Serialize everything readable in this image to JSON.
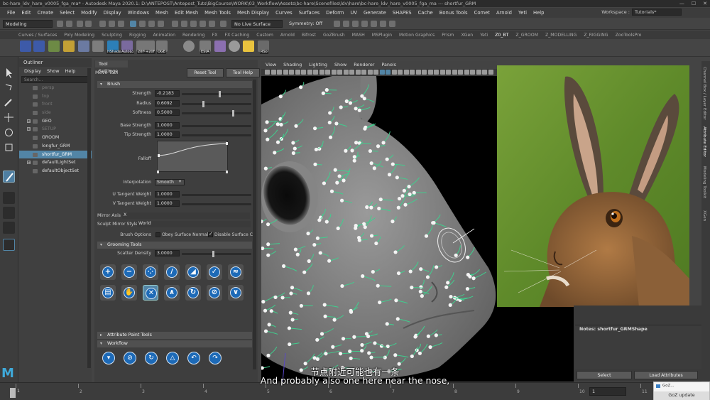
{
  "window": {
    "title": "bc-hare_ldv_hare_v0005_fga_ma* - Autodesk Maya 2020.1: D:\\ANTEPOST\\Antepost_Tuts\\BigCourse\\WORK\\03_Workflow\\Assets\\bc-hare\\Scenefiles\\ldv\\hare\\bc-hare_ldv_hare_v0005_fga_ma --- shortfur_GRM",
    "controls": [
      "—",
      "☐",
      "✕"
    ]
  },
  "menubar": [
    "File",
    "Edit",
    "Create",
    "Select",
    "Modify",
    "Display",
    "Windows",
    "Mesh",
    "Edit Mesh",
    "Mesh Tools",
    "Mesh Display",
    "Curves",
    "Surfaces",
    "Deform",
    "UV",
    "Generate",
    "SHAPES",
    "Cache",
    "Bonus Tools",
    "Comet",
    "Arnold",
    "Yeti",
    "Help"
  ],
  "workspace": {
    "label": "Workspace :",
    "value": "Tutorials*"
  },
  "statusline": {
    "mode": "Modeling",
    "live": "No Live Surface",
    "symmetry": "Symmetry: Off"
  },
  "shelf_tabs": [
    "Curves / Surfaces",
    "Poly Modeling",
    "Sculpting",
    "Rigging",
    "Animation",
    "Rendering",
    "FX",
    "FX Caching",
    "Custom",
    "Arnold",
    "Bifrost",
    "GoZBrush",
    "MASH",
    "MSPlugin",
    "Motion Graphics",
    "Prism",
    "XGen",
    "Yeti",
    "Z0_BT",
    "Z_GROOM",
    "Z_MODELLING",
    "Z_RIGGING",
    "ZooToolsPro"
  ],
  "shelf_active": "Z0_BT",
  "shelf_labels": [
    "HShade",
    "AutoLo",
    "20F",
    "+20F",
    "OGE",
    "EStA",
    "RSo"
  ],
  "outliner": {
    "title": "Outliner",
    "menu": [
      "Display",
      "Show",
      "Help"
    ],
    "search_placeholder": "Search...",
    "items": [
      {
        "label": "persp",
        "dim": true,
        "exp": ""
      },
      {
        "label": "top",
        "dim": true,
        "exp": ""
      },
      {
        "label": "front",
        "dim": true,
        "exp": ""
      },
      {
        "label": "side",
        "dim": true,
        "exp": ""
      },
      {
        "label": "GEO",
        "dim": false,
        "exp": "+"
      },
      {
        "label": "SETUP",
        "dim": true,
        "exp": "+"
      },
      {
        "label": "GROOM",
        "dim": false,
        "exp": ""
      },
      {
        "label": "longfur_GRM",
        "dim": false,
        "exp": ""
      },
      {
        "label": "shortfur_GRM",
        "dim": false,
        "exp": "",
        "selected": true
      },
      {
        "label": "defaultLightSet",
        "dim": false,
        "exp": "+"
      },
      {
        "label": "defaultObjectSet",
        "dim": false,
        "exp": ""
      }
    ]
  },
  "tool_settings": {
    "tab": "Tool Settings",
    "tool_name": "Move Tool",
    "reset_label": "Reset Tool",
    "help_label": "Tool Help",
    "brush_section": "Brush",
    "strength": {
      "label": "Strength",
      "value": "-0.2183",
      "level": 0.55
    },
    "radius": {
      "label": "Radius",
      "value": "0.6092",
      "level": 0.3
    },
    "softness": {
      "label": "Softness",
      "value": "0.5000",
      "level": 0.75
    },
    "base_strength": {
      "label": "Base Strength",
      "value": "1.0000"
    },
    "tip_strength": {
      "label": "Tip Strength",
      "value": "1.0000"
    },
    "falloff_label": "Falloff",
    "interpolation": {
      "label": "Interpolation",
      "value": "Smooth"
    },
    "u_tangent": {
      "label": "U Tangent Weight",
      "value": "1.0000"
    },
    "v_tangent": {
      "label": "V Tangent Weight",
      "value": "1.0000"
    },
    "mirror_axis": {
      "label": "Mirror Axis",
      "value": "X"
    },
    "mirror_style": {
      "label": "Sculpt Mirror Style",
      "value": "World"
    },
    "brush_options": {
      "label": "Brush Options",
      "obey": "Obey Surface Normal",
      "disable": "Disable Surface Col"
    },
    "grooming_section": "Grooming Tools",
    "scatter_density": {
      "label": "Scatter Density",
      "value": "3.0000",
      "level": 0.45
    },
    "groom_icons": [
      "+",
      "−",
      "⁘",
      "/",
      "◢",
      "✓",
      "≈",
      "▤",
      "✋",
      "✕",
      "∧",
      "↻",
      "⊘",
      "∨"
    ],
    "attr_paint_section": "Attribute Paint Tools",
    "workflow_section": "Workflow",
    "workflow_icons": [
      "▾",
      "⊘",
      "↻",
      "△",
      "↶",
      "↷"
    ]
  },
  "viewport": {
    "menu": [
      "View",
      "Shading",
      "Lighting",
      "Show",
      "Renderer",
      "Panels"
    ]
  },
  "right_panel": {
    "notes_label": "Notes: shortfur_GRMShape",
    "select_label": "Select",
    "load_label": "Load Attributes",
    "side_tabs": [
      "Channel Box / Layer Editor",
      "Attribute Editor",
      "Modeling Toolkit",
      "XGen"
    ]
  },
  "timeline": {
    "ticks": [
      "1",
      "2",
      "3",
      "4",
      "5",
      "6",
      "7",
      "8",
      "9",
      "10",
      "11"
    ],
    "frame": "1",
    "start": "1"
  },
  "goz": {
    "title": "GoZ...",
    "button": "GoZ update"
  },
  "subtitles": {
    "chinese": "节点附近可能也有一条",
    "english": "And probably also one here near the nose,"
  },
  "colors": {
    "selection": "#5285a6",
    "icon_blue": "#1d6ab7",
    "guide_green": "#3fcf8e"
  }
}
